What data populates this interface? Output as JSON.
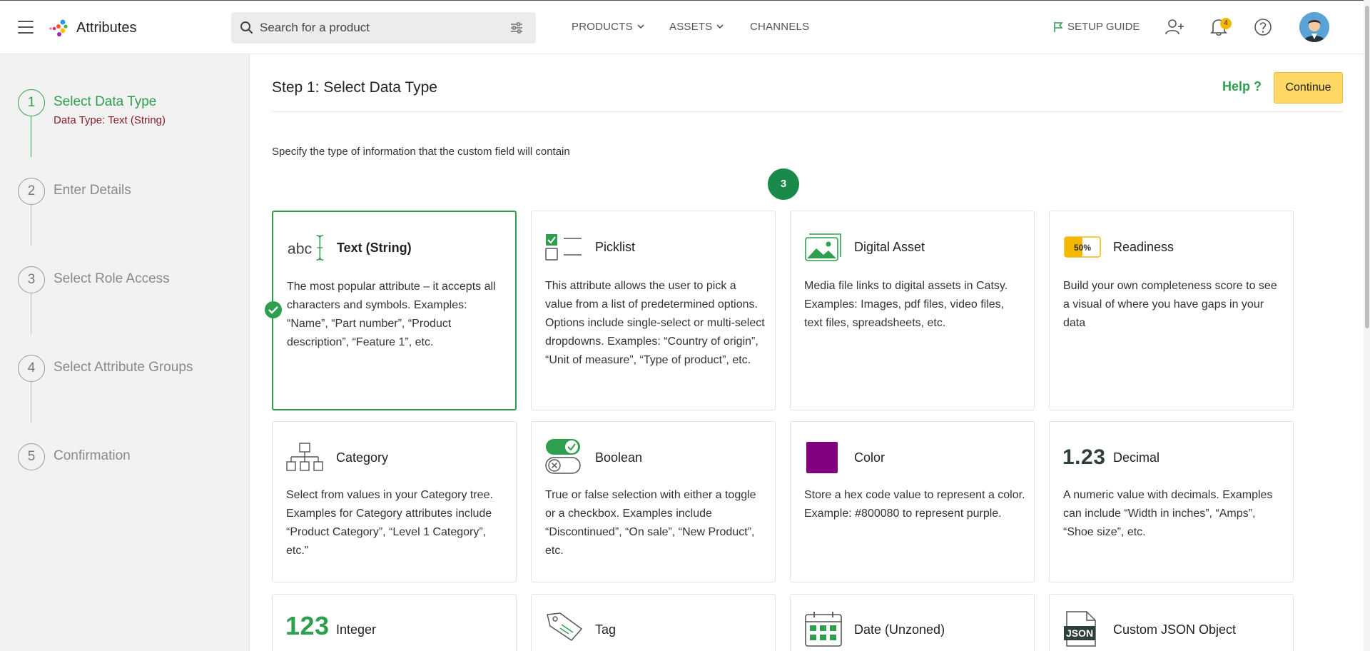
{
  "header": {
    "app_title": "Attributes",
    "search_placeholder": "Search for a product",
    "nav": [
      {
        "label": "PRODUCTS",
        "has_dropdown": true
      },
      {
        "label": "ASSETS",
        "has_dropdown": true
      },
      {
        "label": "CHANNELS",
        "has_dropdown": false
      }
    ],
    "setup_guide": "SETUP GUIDE",
    "notification_count": "4",
    "icons": [
      "menu-icon",
      "search-icon",
      "filter-icon",
      "flag-icon",
      "add-user-icon",
      "bell-icon",
      "help-icon"
    ]
  },
  "sidebar": {
    "steps": [
      {
        "number": "1",
        "label": "Select Data Type",
        "sub": "Data Type: Text (String)",
        "active": true
      },
      {
        "number": "2",
        "label": "Enter Details"
      },
      {
        "number": "3",
        "label": "Select Role Access"
      },
      {
        "number": "4",
        "label": "Select Attribute Groups"
      },
      {
        "number": "5",
        "label": "Confirmation"
      }
    ]
  },
  "main": {
    "title": "Step 1: Select Data Type",
    "help": "Help ?",
    "continue": "Continue",
    "intro": "Specify the type of information that the custom field will contain",
    "count_badge": "3",
    "cards": [
      {
        "title": "Text (String)",
        "icon": "text-cursor-icon",
        "selected": true,
        "desc": "The most popular attribute – it accepts all characters and symbols. Examples: “Name”, “Part number”, “Product description”, “Feature 1”, etc."
      },
      {
        "title": "Picklist",
        "icon": "checklist-icon",
        "desc": "This attribute allows the user to pick a value from a list of predetermined options. Options include single-select or multi-select dropdowns. Examples: “Country of origin”, “Unit of measure”, “Type of product”, etc."
      },
      {
        "title": "Digital Asset",
        "icon": "image-icon",
        "desc": "Media file links to digital assets in Catsy. Examples: Images, pdf files, video files, text files, spreadsheets, etc."
      },
      {
        "title": "Readiness",
        "icon": "progress-icon",
        "readiness_value": "50%",
        "desc": "Build your own completeness score to see a visual of where you have gaps in your data"
      },
      {
        "title": "Category",
        "icon": "tree-icon",
        "desc": "Select from values in your Category tree. Examples for Category attributes include “Product Category”, “Level 1 Category”, etc.\""
      },
      {
        "title": "Boolean",
        "icon": "toggle-icon",
        "desc": "True or false selection with either a toggle or a checkbox. Examples include “Discontinued”, “On sale”, “New Product”, etc."
      },
      {
        "title": "Color",
        "icon": "color-swatch-icon",
        "swatch": "#800080",
        "desc": "Store a hex code value to represent a color. Example: #800080 to represent purple."
      },
      {
        "title": "Decimal",
        "icon": "decimal-icon",
        "icon_text": "1.23",
        "desc": "A numeric value with decimals. Examples can include “Width in inches”, “Amps”, “Shoe size”, etc."
      },
      {
        "title": "Integer",
        "icon": "integer-icon",
        "icon_text": "123",
        "desc": ""
      },
      {
        "title": "Tag",
        "icon": "tag-icon",
        "desc": ""
      },
      {
        "title": "Date (Unzoned)",
        "icon": "calendar-icon",
        "desc": ""
      },
      {
        "title": "Custom JSON Object",
        "icon": "json-file-icon",
        "icon_text": "JSON",
        "desc": ""
      }
    ]
  },
  "colors": {
    "accent_green": "#2e9e4f",
    "continue_yellow": "#ffd866",
    "sub_label": "#8b1a2b",
    "badge": "#1a8a4a"
  }
}
